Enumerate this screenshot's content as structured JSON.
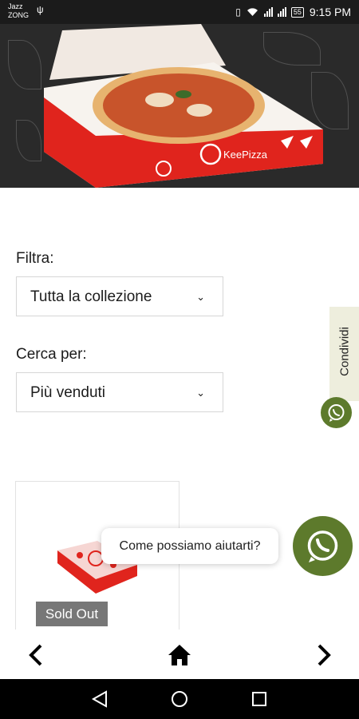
{
  "status": {
    "carrier_line1": "Jazz",
    "carrier_line2": "ZONG",
    "battery": "55",
    "time": "9:15 PM"
  },
  "hero": {
    "brand_logo_text": "KeePizza"
  },
  "filter": {
    "label": "Filtra:",
    "selected": "Tutta la collezione"
  },
  "sort": {
    "label": "Cerca per:",
    "selected": "Più venduti"
  },
  "share": {
    "label": "Condividi"
  },
  "product": {
    "badge": "Sold Out"
  },
  "chat": {
    "prompt": "Come possiamo aiutarti?"
  },
  "colors": {
    "whatsapp_green": "#5d7a2c",
    "share_tab_bg": "#eeeedd",
    "soldout_bg": "#777777",
    "box_red": "#e0241d"
  },
  "icons": {
    "back": "chevron-left-icon",
    "home": "home-icon",
    "forward": "chevron-right-icon",
    "whatsapp": "whatsapp-icon",
    "dropdown": "chevron-down-icon"
  }
}
